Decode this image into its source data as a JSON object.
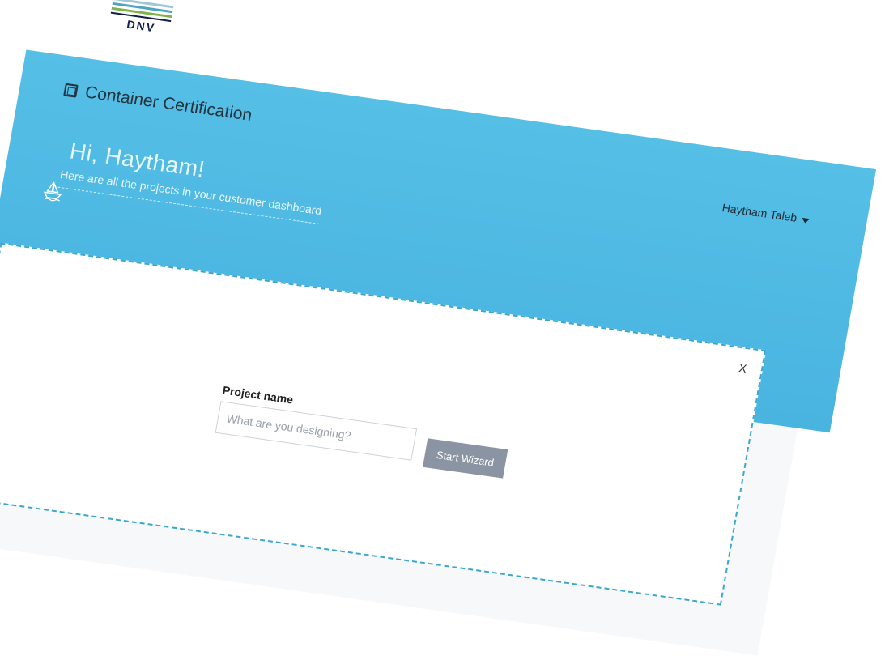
{
  "brand": {
    "logo_text": "DNV"
  },
  "header": {
    "app_title": "Container Certification",
    "user_name": "Haytham Taleb"
  },
  "hero": {
    "greeting": "Hi, Haytham!",
    "subline": "Here are all the projects in your customer dashboard"
  },
  "wizard": {
    "project_name_label": "Project name",
    "project_name_placeholder": "What are you designing?",
    "project_name_value": "",
    "start_button_label": "Start Wizard",
    "close_label": "X"
  },
  "colors": {
    "accent": "#49b4e0",
    "brand_navy": "#0f204b",
    "button": "#8b94a3",
    "dashed_border": "#3aa7cf"
  },
  "icons": {
    "app": "container-cube-icon",
    "user_menu": "caret-down-icon",
    "hero": "sailboat-icon",
    "close": "close-icon"
  }
}
